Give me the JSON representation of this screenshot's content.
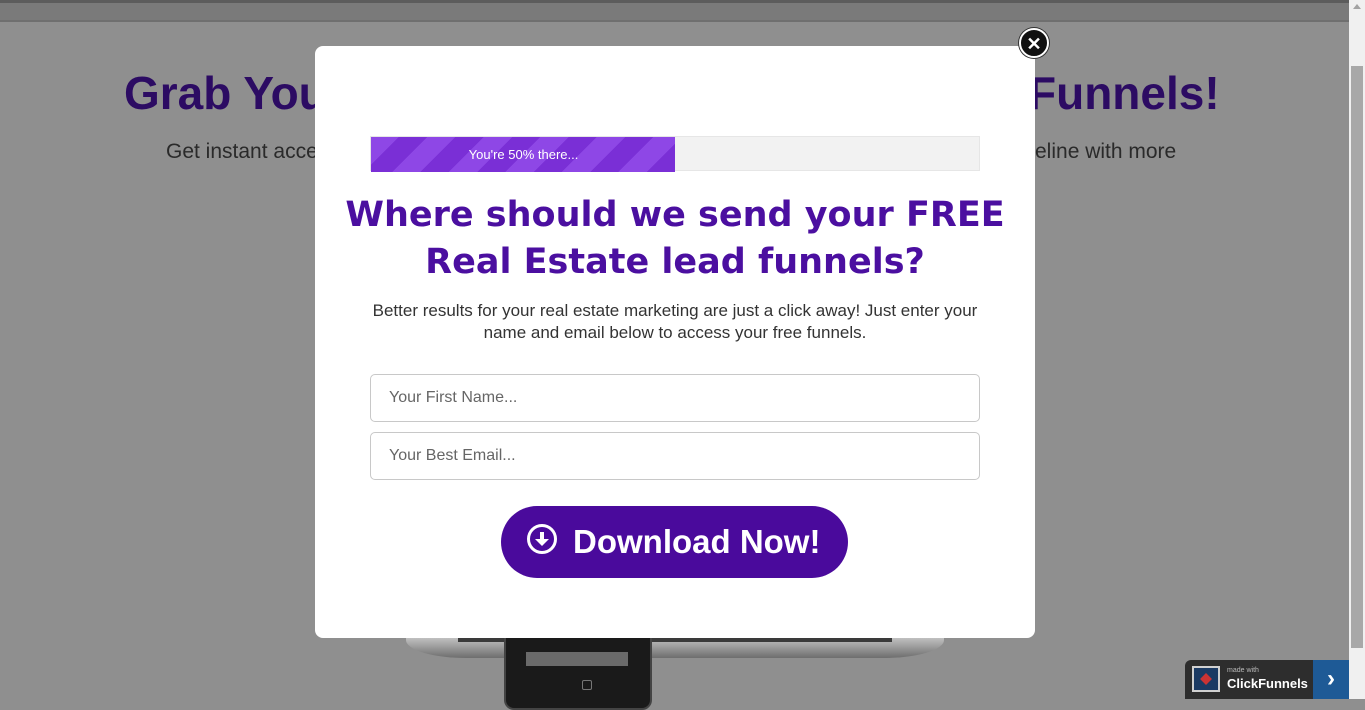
{
  "background": {
    "headline_left": "Grab You",
    "headline_right": "Funnels!",
    "subheadline_left": "Get instant acce",
    "subheadline_right": "eline with more"
  },
  "modal": {
    "progress": {
      "percent": 50,
      "label": "You're 50% there..."
    },
    "title": "Where should we send your FREE Real Estate lead funnels?",
    "description": "Better results for your real estate marketing are just a click away! Just enter your name and email below to access your free funnels.",
    "first_name_placeholder": "Your First Name...",
    "email_placeholder": "Your Best Email...",
    "cta_label": "Download Now!",
    "close_symbol": "✕"
  },
  "badge": {
    "small_text": "made with",
    "name": "ClickFunnels",
    "arrow": "›"
  },
  "colors": {
    "accent": "#4a0a9c",
    "progress": "#7a2fd6",
    "headline": "#2c0b63"
  },
  "icons": [
    "close-icon",
    "download-arrow-icon",
    "clickfunnels-logo-icon",
    "chevron-right-icon"
  ]
}
